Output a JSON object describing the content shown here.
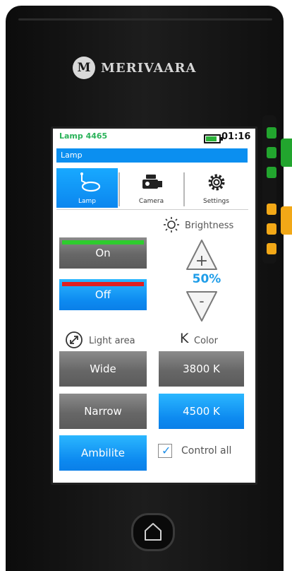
{
  "brand": {
    "logo_letter": "M",
    "name": "MERIVAARA"
  },
  "status": {
    "lamp_name": "Lamp 4465",
    "time": "01:16",
    "battery_level_percent": 85
  },
  "title_bar": {
    "title": "Lamp"
  },
  "tabs": [
    {
      "label": "Lamp",
      "icon": "lamp-icon",
      "active": true
    },
    {
      "label": "Camera",
      "icon": "camera-icon",
      "active": false
    },
    {
      "label": "Settings",
      "icon": "gear-icon",
      "active": false
    }
  ],
  "power": {
    "on_label": "On",
    "off_label": "Off",
    "on_indicator_color": "#2ecc2e",
    "off_indicator_color": "#e02020"
  },
  "brightness": {
    "label": "Brightness",
    "value": "50%",
    "increase_symbol": "+",
    "decrease_symbol": "-"
  },
  "light_area": {
    "label": "Light area",
    "options": [
      "Wide",
      "Narrow",
      "Ambilite"
    ],
    "selected": "Ambilite"
  },
  "color": {
    "icon_letter": "K",
    "label": "Color",
    "options": [
      "3800 K",
      "4500 K"
    ],
    "selected": "4500 K"
  },
  "control_all": {
    "label": "Control all",
    "checked": true
  },
  "colors": {
    "accent_blue": "#0b8ff0",
    "status_green": "#2bb35a",
    "button_grey": "#6e6e6e"
  }
}
